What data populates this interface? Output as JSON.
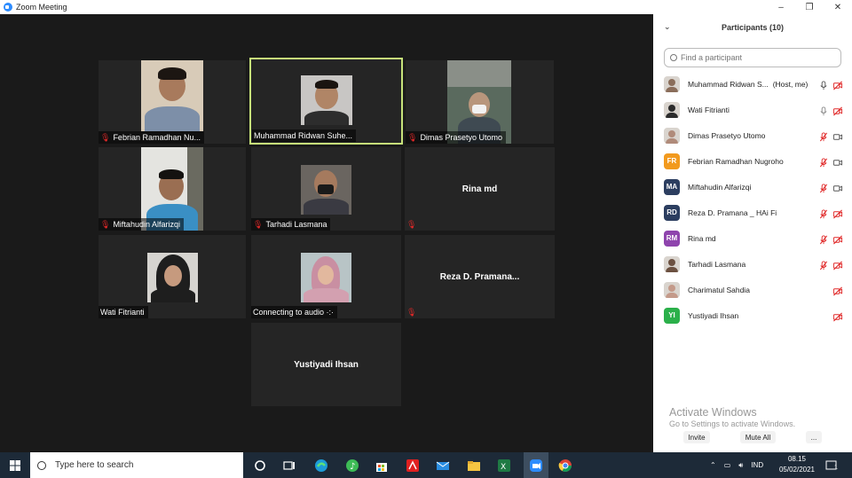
{
  "window": {
    "title": "Zoom Meeting",
    "minimize": "–",
    "maximize": "❐",
    "close": "✕"
  },
  "tiles": [
    {
      "name": "Febrian Ramadhan Nu...",
      "muted": true
    },
    {
      "name": "Muhammad Ridwan Suhe...",
      "muted": false,
      "active": true
    },
    {
      "name": "Dimas Prasetyo Utomo",
      "muted": true
    },
    {
      "name": "Miftahudin Alfarizqi",
      "muted": true
    },
    {
      "name": "Tarhadi Lasmana",
      "muted": true
    },
    {
      "name": "Rina md",
      "center": "Rina md",
      "muted": true
    },
    {
      "name": "Wati Fitrianti",
      "muted": false
    },
    {
      "name": "Connecting to audio ·:·",
      "muted": false
    },
    {
      "name": "Reza D. Pramana...",
      "center": "Reza D. Pramana...",
      "muted": true
    },
    {
      "center": "Yustiyadi Ihsan"
    }
  ],
  "sidebar": {
    "title": "Participants (10)",
    "collapse_icon": "chevron-down-icon",
    "search_placeholder": "Find a participant",
    "participants": [
      {
        "name": "Muhammad Ridwan S...",
        "tag": "(Host, me)",
        "avatar": "photo",
        "color": "#8a6d5a",
        "mic": "on",
        "video": "off"
      },
      {
        "name": "Wati Fitrianti",
        "avatar": "photo",
        "color": "#2b2b2b",
        "mic": "on-gray",
        "video": "off"
      },
      {
        "name": "Dimas Prasetyo Utomo",
        "avatar": "photo",
        "color": "#b08b7a",
        "mic": "muted",
        "video": "on"
      },
      {
        "name": "Febrian Ramadhan Nugroho",
        "initials": "FR",
        "color": "#f29a1e",
        "mic": "muted",
        "video": "on"
      },
      {
        "name": "Miftahudin Alfarizqi",
        "initials": "MA",
        "color": "#2c3e60",
        "mic": "muted",
        "video": "on"
      },
      {
        "name": "Reza D. Pramana _ HAi Fi",
        "initials": "RD",
        "color": "#2c3e60",
        "mic": "muted",
        "video": "off"
      },
      {
        "name": "Rina md",
        "initials": "RM",
        "color": "#8e44ad",
        "mic": "muted",
        "video": "off"
      },
      {
        "name": "Tarhadi Lasmana",
        "avatar": "photo",
        "color": "#6b5040",
        "mic": "muted",
        "video": "off"
      },
      {
        "name": "Charimatul Sahdia",
        "avatar": "photo",
        "color": "#c49a8a",
        "mic": "none",
        "video": "off"
      },
      {
        "name": "Yustiyadi Ihsan",
        "initials": "YI",
        "color": "#2bb04a",
        "mic": "none",
        "video": "off"
      }
    ],
    "watermark_line1": "Activate Windows",
    "watermark_line2": "Go to Settings to activate Windows.",
    "invite_label": "Invite",
    "mute_all_label": "Mute All",
    "more_label": "..."
  },
  "taskbar": {
    "search_placeholder": "Type here to search",
    "language": "IND",
    "time": "08.15",
    "date": "05/02/2021",
    "notification_count": "1"
  },
  "colors": {
    "active_border": "#c7e27a",
    "muted_red": "#e02828",
    "zoom_blue": "#2d8cff"
  }
}
